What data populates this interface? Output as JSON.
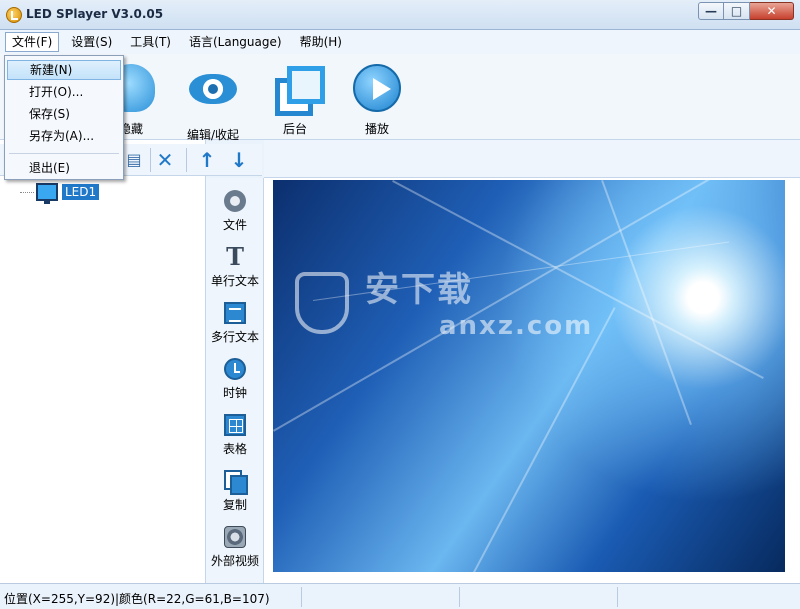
{
  "window": {
    "title": "LED SPlayer V3.0.05",
    "buttons": {
      "minimize": "—",
      "maximize": "□",
      "close": "✕"
    }
  },
  "menubar": {
    "items": [
      "文件(F)",
      "设置(S)",
      "工具(T)",
      "语言(Language)",
      "帮助(H)"
    ]
  },
  "file_menu": {
    "items": [
      "新建(N)",
      "打开(O)...",
      "保存(S)",
      "另存为(A)...",
      "退出(E)"
    ]
  },
  "toolbar": {
    "items": [
      "隐藏",
      "编辑/收起",
      "后台",
      "播放"
    ]
  },
  "tree": {
    "buttons": [
      "✕",
      "↑",
      "↓"
    ],
    "node_label": "LED1"
  },
  "palette": {
    "items": [
      "文件",
      "单行文本",
      "多行文本",
      "时钟",
      "表格",
      "复制",
      "外部视频"
    ]
  },
  "preview": {
    "watermark_text": "安下载",
    "watermark_sub": "anxz.com"
  },
  "status": {
    "text": "位置(X=255,Y=92)|颜色(R=22,G=61,B=107)"
  }
}
